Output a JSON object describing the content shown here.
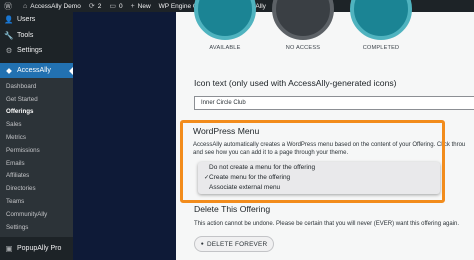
{
  "adminbar": {
    "wp_icon": "wordpress-logo-icon",
    "site_name": "AccessAlly Demo",
    "updates_count": "2",
    "comments_count": "0",
    "new_label": "New",
    "wpengine_label": "WP Engine Quick Links",
    "accessally_label": "AccessAlly"
  },
  "sidebar": {
    "top_items": [
      {
        "label": "Users",
        "icon": "users-icon"
      },
      {
        "label": "Tools",
        "icon": "wrench-icon"
      },
      {
        "label": "Settings",
        "icon": "settings-icon"
      }
    ],
    "active": {
      "label": "AccessAlly",
      "icon": "accessally-icon"
    },
    "submenu": [
      "Dashboard",
      "Get Started",
      "Offerings",
      "Sales",
      "Metrics",
      "Permissions",
      "Emails",
      "Affiliates",
      "Directories",
      "Teams",
      "CommunityAlly",
      "Settings"
    ],
    "current_submenu": "Offerings",
    "bottom_items": [
      {
        "label": "PopupAlly Pro",
        "icon": "popup-icon"
      }
    ]
  },
  "status_badges": [
    "AVAILABLE",
    "NO ACCESS",
    "COMPLETED"
  ],
  "icon_text": {
    "label": "Icon text (only used with AccessAlly-generated icons)",
    "value": "Inner Circle Club"
  },
  "wp_menu": {
    "title": "WordPress Menu",
    "description_line1": "AccessAlly automatically creates a WordPress menu based on the content of your Offering. Click throu",
    "description_line2": "and see how you can add it to a page through your theme.",
    "options": [
      {
        "label": "Do not create a menu for the offering",
        "selected": false
      },
      {
        "label": "Create menu for the offering",
        "selected": true
      },
      {
        "label": "Associate external menu",
        "selected": false
      }
    ],
    "highlight_color": "#f28c1c"
  },
  "delete": {
    "title": "Delete This Offering",
    "warning": "This action cannot be undone. Please be certain that you will never (EVER) want this offering again.",
    "button_label": "DELETE FOREVER"
  },
  "colors": {
    "admin_dark": "#1d2327",
    "admin_blue": "#2271b1",
    "teal": "#1b8494",
    "navy": "#0e1a37"
  }
}
